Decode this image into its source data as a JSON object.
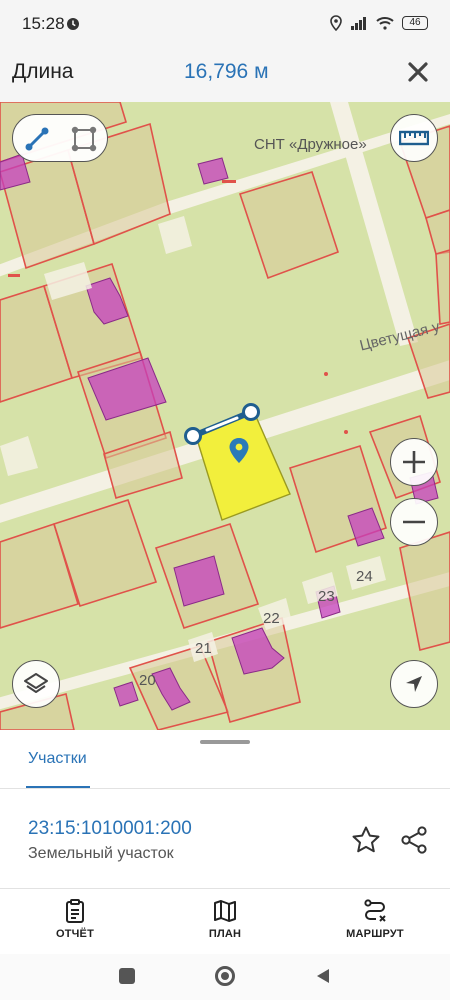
{
  "status_bar": {
    "time": "15:28",
    "battery": "46",
    "icons": [
      "alarm-icon",
      "location-icon",
      "signal-icon",
      "wifi-icon",
      "battery-icon"
    ]
  },
  "header": {
    "title": "Длина",
    "value": "16,796 м",
    "close_icon": "close-icon"
  },
  "map": {
    "place_label": "СНТ «Дружное»",
    "street_label": "Цветущая у",
    "house_numbers": [
      "24",
      "23",
      "22",
      "21",
      "20"
    ],
    "tools": [
      "measure-line-icon",
      "measure-area-icon"
    ],
    "ruler_icon": "ruler-icon",
    "zoom_in_icon": "plus-icon",
    "zoom_out_icon": "minus-icon",
    "layers_icon": "layers-icon",
    "locate_icon": "navigation-arrow-icon",
    "colors": {
      "background": "#d6e2a8",
      "parcel_border": "#e0524a",
      "parcel_fill": "#d8c998",
      "building": "#c53fbf",
      "selected": "#f2ef3c",
      "measure_line": "#1f5e8f"
    }
  },
  "sheet": {
    "tab": "Участки",
    "parcel_number": "23:15:1010001:200",
    "parcel_type": "Земельный участок",
    "actions": [
      "star-icon",
      "share-icon"
    ]
  },
  "bottom_nav": [
    {
      "label": "ОТЧЁТ",
      "icon": "report-icon"
    },
    {
      "label": "ПЛАН",
      "icon": "map-icon"
    },
    {
      "label": "МАРШРУТ",
      "icon": "route-icon"
    }
  ],
  "system_nav": [
    "square-icon",
    "circle-icon",
    "back-icon"
  ]
}
